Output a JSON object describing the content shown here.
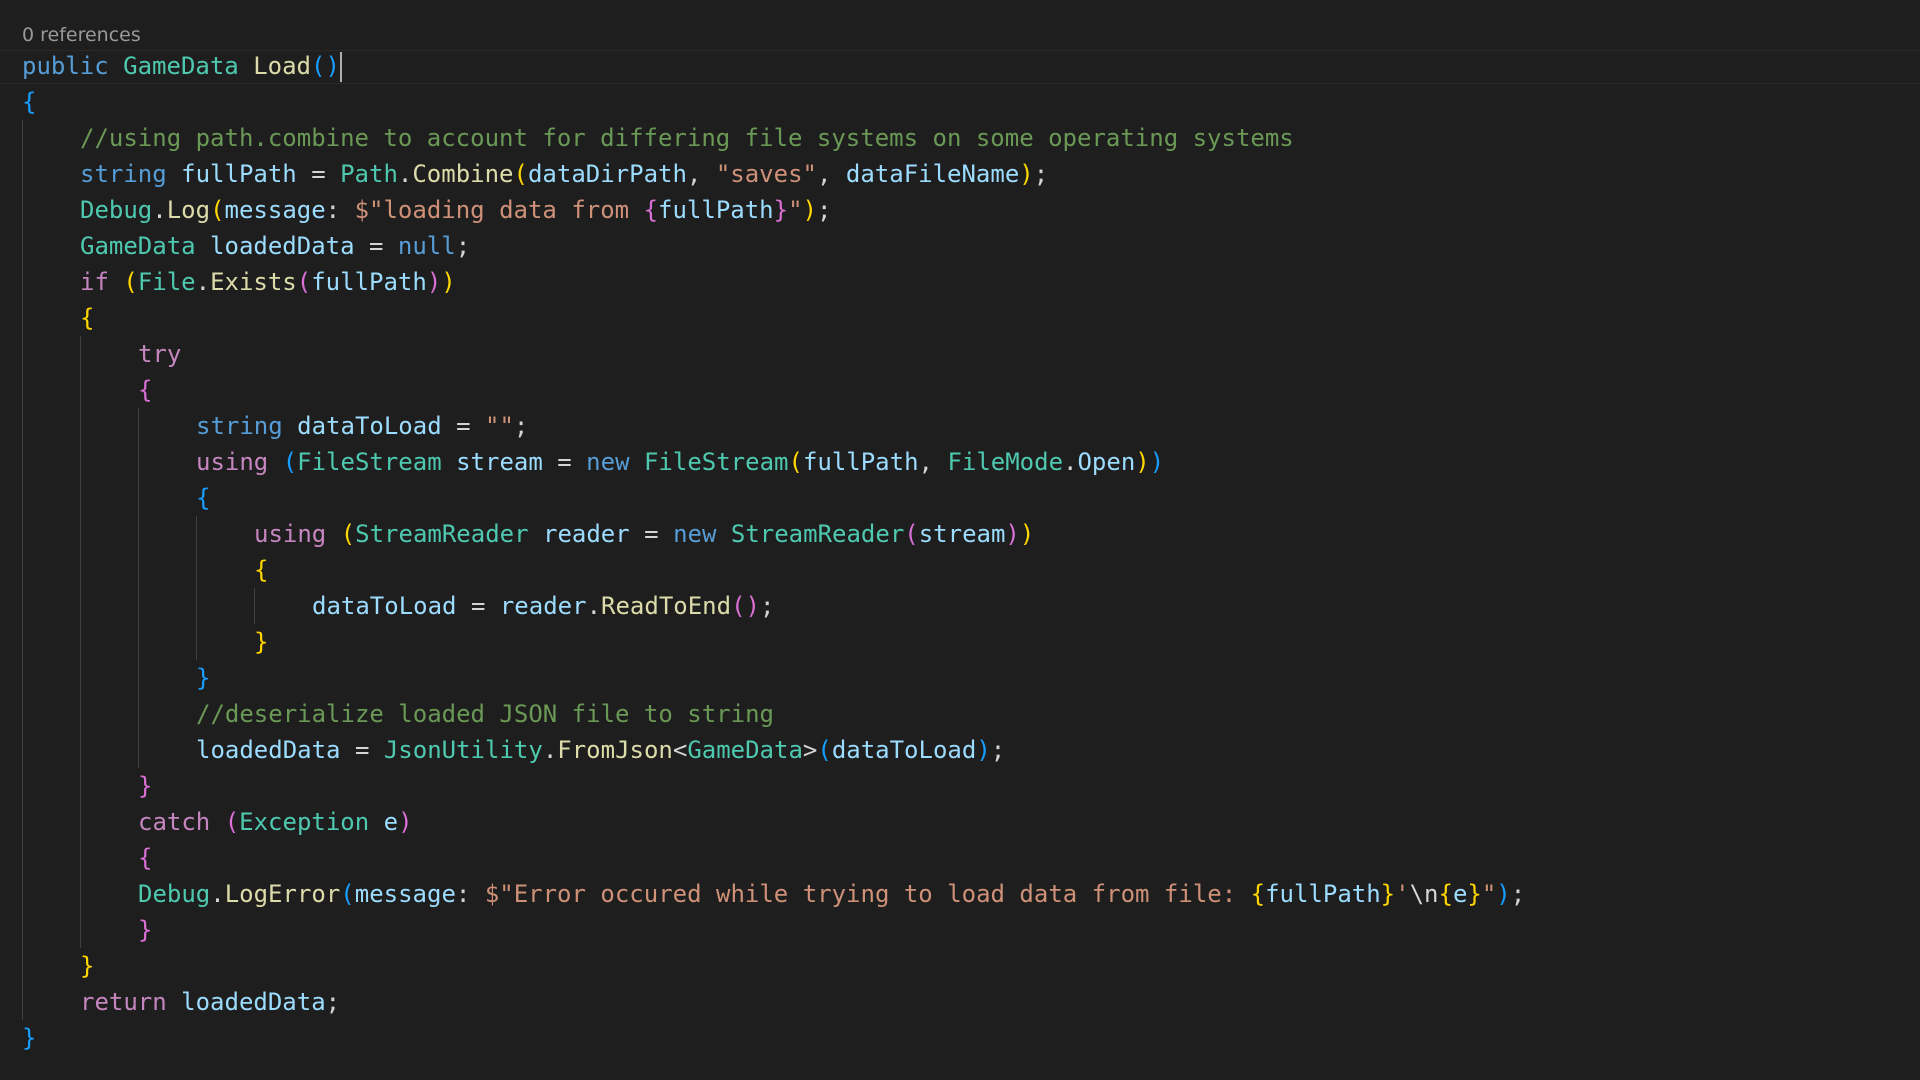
{
  "editor": {
    "codelens": "0 references",
    "lines": [
      {
        "indent": 0,
        "tokens": [
          {
            "t": "public",
            "c": "kw"
          },
          {
            "t": " ",
            "c": "pl"
          },
          {
            "t": "GameData",
            "c": "type"
          },
          {
            "t": " ",
            "c": "pl"
          },
          {
            "t": "Load",
            "c": "fn"
          },
          {
            "t": "()",
            "c": "p3"
          }
        ],
        "cursor": true
      },
      {
        "indent": 0,
        "tokens": [
          {
            "t": "{",
            "c": "p3"
          }
        ]
      },
      {
        "indent": 1,
        "tokens": [
          {
            "t": "//using path.combine to account for differing file systems on some operating systems",
            "c": "cmt"
          }
        ]
      },
      {
        "indent": 1,
        "tokens": [
          {
            "t": "string",
            "c": "kw"
          },
          {
            "t": " ",
            "c": "pl"
          },
          {
            "t": "fullPath",
            "c": "var"
          },
          {
            "t": " = ",
            "c": "pl"
          },
          {
            "t": "Path",
            "c": "type"
          },
          {
            "t": ".",
            "c": "pl"
          },
          {
            "t": "Combine",
            "c": "fn"
          },
          {
            "t": "(",
            "c": "p1"
          },
          {
            "t": "dataDirPath",
            "c": "var"
          },
          {
            "t": ", ",
            "c": "pl"
          },
          {
            "t": "\"saves\"",
            "c": "str"
          },
          {
            "t": ", ",
            "c": "pl"
          },
          {
            "t": "dataFileName",
            "c": "var"
          },
          {
            "t": ")",
            "c": "p1"
          },
          {
            "t": ";",
            "c": "pl"
          }
        ]
      },
      {
        "indent": 1,
        "tokens": [
          {
            "t": "Debug",
            "c": "type"
          },
          {
            "t": ".",
            "c": "pl"
          },
          {
            "t": "Log",
            "c": "fn"
          },
          {
            "t": "(",
            "c": "p1"
          },
          {
            "t": "message",
            "c": "var"
          },
          {
            "t": ": ",
            "c": "pl"
          },
          {
            "t": "$\"loading data from ",
            "c": "str"
          },
          {
            "t": "{",
            "c": "p2"
          },
          {
            "t": "fullPath",
            "c": "var"
          },
          {
            "t": "}",
            "c": "p2"
          },
          {
            "t": "\"",
            "c": "str"
          },
          {
            "t": ")",
            "c": "p1"
          },
          {
            "t": ";",
            "c": "pl"
          }
        ]
      },
      {
        "indent": 1,
        "tokens": [
          {
            "t": "GameData",
            "c": "type"
          },
          {
            "t": " ",
            "c": "pl"
          },
          {
            "t": "loadedData",
            "c": "var"
          },
          {
            "t": " = ",
            "c": "pl"
          },
          {
            "t": "null",
            "c": "kw"
          },
          {
            "t": ";",
            "c": "pl"
          }
        ]
      },
      {
        "indent": 1,
        "tokens": [
          {
            "t": "if",
            "c": "ctl"
          },
          {
            "t": " ",
            "c": "pl"
          },
          {
            "t": "(",
            "c": "p1"
          },
          {
            "t": "File",
            "c": "type"
          },
          {
            "t": ".",
            "c": "pl"
          },
          {
            "t": "Exists",
            "c": "fn"
          },
          {
            "t": "(",
            "c": "p2"
          },
          {
            "t": "fullPath",
            "c": "var"
          },
          {
            "t": ")",
            "c": "p2"
          },
          {
            "t": ")",
            "c": "p1"
          }
        ]
      },
      {
        "indent": 1,
        "tokens": [
          {
            "t": "{",
            "c": "p1"
          }
        ]
      },
      {
        "indent": 2,
        "tokens": [
          {
            "t": "try",
            "c": "ctl"
          }
        ]
      },
      {
        "indent": 2,
        "tokens": [
          {
            "t": "{",
            "c": "p2"
          }
        ]
      },
      {
        "indent": 3,
        "tokens": [
          {
            "t": "string",
            "c": "kw"
          },
          {
            "t": " ",
            "c": "pl"
          },
          {
            "t": "dataToLoad",
            "c": "var"
          },
          {
            "t": " = ",
            "c": "pl"
          },
          {
            "t": "\"\"",
            "c": "str"
          },
          {
            "t": ";",
            "c": "pl"
          }
        ]
      },
      {
        "indent": 3,
        "tokens": [
          {
            "t": "using",
            "c": "ctl"
          },
          {
            "t": " ",
            "c": "pl"
          },
          {
            "t": "(",
            "c": "p3"
          },
          {
            "t": "FileStream",
            "c": "type"
          },
          {
            "t": " ",
            "c": "pl"
          },
          {
            "t": "stream",
            "c": "var"
          },
          {
            "t": " = ",
            "c": "pl"
          },
          {
            "t": "new",
            "c": "kw"
          },
          {
            "t": " ",
            "c": "pl"
          },
          {
            "t": "FileStream",
            "c": "type"
          },
          {
            "t": "(",
            "c": "p1"
          },
          {
            "t": "fullPath",
            "c": "var"
          },
          {
            "t": ", ",
            "c": "pl"
          },
          {
            "t": "FileMode",
            "c": "type"
          },
          {
            "t": ".",
            "c": "pl"
          },
          {
            "t": "Open",
            "c": "var"
          },
          {
            "t": ")",
            "c": "p1"
          },
          {
            "t": ")",
            "c": "p3"
          }
        ]
      },
      {
        "indent": 3,
        "tokens": [
          {
            "t": "{",
            "c": "p3"
          }
        ]
      },
      {
        "indent": 4,
        "tokens": [
          {
            "t": "using",
            "c": "ctl"
          },
          {
            "t": " ",
            "c": "pl"
          },
          {
            "t": "(",
            "c": "p1"
          },
          {
            "t": "StreamReader",
            "c": "type"
          },
          {
            "t": " ",
            "c": "pl"
          },
          {
            "t": "reader",
            "c": "var"
          },
          {
            "t": " = ",
            "c": "pl"
          },
          {
            "t": "new",
            "c": "kw"
          },
          {
            "t": " ",
            "c": "pl"
          },
          {
            "t": "StreamReader",
            "c": "type"
          },
          {
            "t": "(",
            "c": "p2"
          },
          {
            "t": "stream",
            "c": "var"
          },
          {
            "t": ")",
            "c": "p2"
          },
          {
            "t": ")",
            "c": "p1"
          }
        ]
      },
      {
        "indent": 4,
        "tokens": [
          {
            "t": "{",
            "c": "p1"
          }
        ]
      },
      {
        "indent": 5,
        "tokens": [
          {
            "t": "dataToLoad",
            "c": "var"
          },
          {
            "t": " = ",
            "c": "pl"
          },
          {
            "t": "reader",
            "c": "var"
          },
          {
            "t": ".",
            "c": "pl"
          },
          {
            "t": "ReadToEnd",
            "c": "fn"
          },
          {
            "t": "()",
            "c": "p2"
          },
          {
            "t": ";",
            "c": "pl"
          }
        ]
      },
      {
        "indent": 4,
        "tokens": [
          {
            "t": "}",
            "c": "p1"
          }
        ]
      },
      {
        "indent": 3,
        "tokens": [
          {
            "t": "}",
            "c": "p3"
          }
        ]
      },
      {
        "indent": 3,
        "tokens": [
          {
            "t": "//deserialize loaded JSON file to string",
            "c": "cmt"
          }
        ]
      },
      {
        "indent": 3,
        "tokens": [
          {
            "t": "loadedData",
            "c": "var"
          },
          {
            "t": " = ",
            "c": "pl"
          },
          {
            "t": "JsonUtility",
            "c": "type"
          },
          {
            "t": ".",
            "c": "pl"
          },
          {
            "t": "FromJson",
            "c": "fn"
          },
          {
            "t": "<",
            "c": "pl"
          },
          {
            "t": "GameData",
            "c": "type"
          },
          {
            "t": ">",
            "c": "pl"
          },
          {
            "t": "(",
            "c": "p3"
          },
          {
            "t": "dataToLoad",
            "c": "var"
          },
          {
            "t": ")",
            "c": "p3"
          },
          {
            "t": ";",
            "c": "pl"
          }
        ]
      },
      {
        "indent": 2,
        "tokens": [
          {
            "t": "}",
            "c": "p2"
          }
        ]
      },
      {
        "indent": 2,
        "tokens": [
          {
            "t": "catch",
            "c": "ctl"
          },
          {
            "t": " ",
            "c": "pl"
          },
          {
            "t": "(",
            "c": "p2"
          },
          {
            "t": "Exception",
            "c": "type"
          },
          {
            "t": " ",
            "c": "pl"
          },
          {
            "t": "e",
            "c": "var"
          },
          {
            "t": ")",
            "c": "p2"
          }
        ]
      },
      {
        "indent": 2,
        "tokens": [
          {
            "t": "{",
            "c": "p2"
          }
        ]
      },
      {
        "indent": 2,
        "tokens": [
          {
            "t": "Debug",
            "c": "type"
          },
          {
            "t": ".",
            "c": "pl"
          },
          {
            "t": "LogError",
            "c": "fn"
          },
          {
            "t": "(",
            "c": "p3"
          },
          {
            "t": "message",
            "c": "var"
          },
          {
            "t": ": ",
            "c": "pl"
          },
          {
            "t": "$\"Error occured while trying to load data from file: ",
            "c": "str"
          },
          {
            "t": "{",
            "c": "p1"
          },
          {
            "t": "fullPath",
            "c": "var"
          },
          {
            "t": "}",
            "c": "p1"
          },
          {
            "t": "'",
            "c": "str"
          },
          {
            "t": "\\n",
            "c": "pl"
          },
          {
            "t": "{",
            "c": "p1"
          },
          {
            "t": "e",
            "c": "var"
          },
          {
            "t": "}",
            "c": "p1"
          },
          {
            "t": "\"",
            "c": "str"
          },
          {
            "t": ")",
            "c": "p3"
          },
          {
            "t": ";",
            "c": "pl"
          }
        ]
      },
      {
        "indent": 2,
        "tokens": [
          {
            "t": "}",
            "c": "p2"
          }
        ]
      },
      {
        "indent": 1,
        "tokens": [
          {
            "t": "}",
            "c": "p1"
          }
        ]
      },
      {
        "indent": 1,
        "tokens": [
          {
            "t": "return",
            "c": "ctl"
          },
          {
            "t": " ",
            "c": "pl"
          },
          {
            "t": "loadedData",
            "c": "var"
          },
          {
            "t": ";",
            "c": "pl"
          }
        ]
      },
      {
        "indent": 0,
        "tokens": [
          {
            "t": "}",
            "c": "p3"
          }
        ]
      }
    ]
  },
  "theme": {
    "background": "#1e1e1e",
    "keyword": "#569cd6",
    "control": "#c586c0",
    "type": "#4ec9b0",
    "function": "#dcdcaa",
    "variable": "#9cdcfe",
    "string": "#ce9178",
    "comment": "#6a9955",
    "bracket1": "#ffd700",
    "bracket2": "#da70d6",
    "bracket3": "#179fff"
  }
}
